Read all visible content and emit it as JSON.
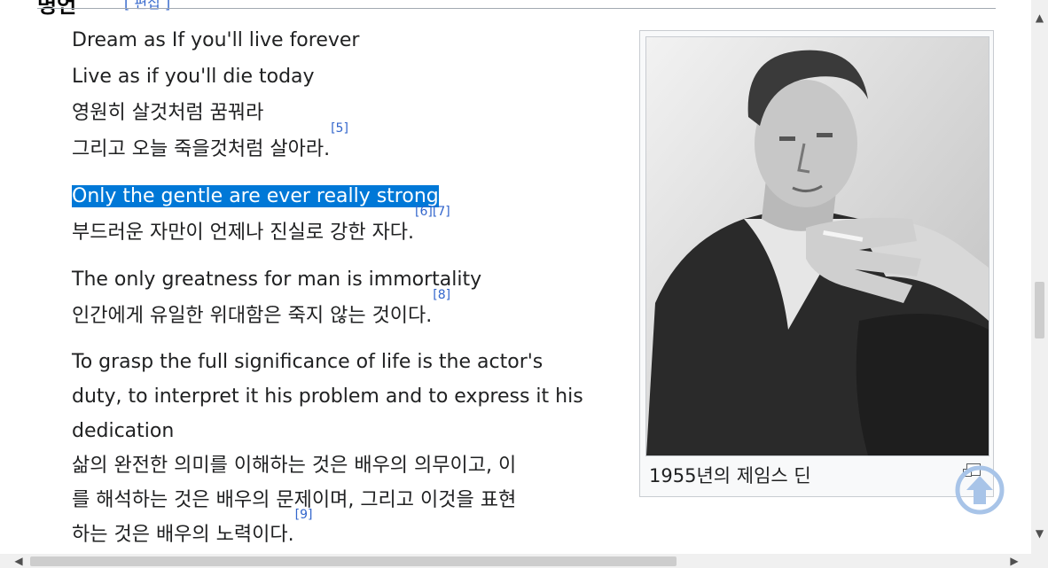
{
  "section": {
    "heading_fragment": "명언",
    "edit_link": "[ 편집 ]"
  },
  "quotes": [
    {
      "lines": [
        "Dream as If you'll live forever",
        "Live as if you'll die today",
        "영원히 살것처럼 꿈꿔라",
        "그리고 오늘 죽을것처럼 살아라."
      ],
      "ref": "[5]"
    },
    {
      "highlighted": "Only the gentle are ever really strong",
      "lines": [
        "부드러운 자만이 언제나 진실로 강한 자다."
      ],
      "ref": "[6][7]"
    },
    {
      "lines": [
        "The only greatness for man is immortality",
        "인간에게 유일한 위대함은 죽지 않는 것이다."
      ],
      "ref": "[8]"
    },
    {
      "lines": [
        "To grasp the full significance of life is the actor's",
        "duty, to interpret it his problem and to express it his",
        "dedication",
        "삶의 완전한 의미를 이해하는 것은 배우의 의무이고, 이",
        "를 해석하는 것은 배우의 문제이며, 그리고 이것을 표현",
        "하는 것은 배우의 노력이다."
      ],
      "ref": "[9]"
    }
  ],
  "figure": {
    "caption": "1955년의 제임스 딘",
    "image_alt": "portrait-photo"
  },
  "colors": {
    "link": "#3366cc",
    "selection": "#0078d7",
    "totop": "#a8c4e8"
  },
  "icons": {
    "scroll_top": "arrow-up-circle-icon",
    "enlarge": "enlarge-icon"
  },
  "scrollbar": {
    "up": "▲",
    "down": "▼",
    "left": "◀",
    "right": "▶"
  }
}
